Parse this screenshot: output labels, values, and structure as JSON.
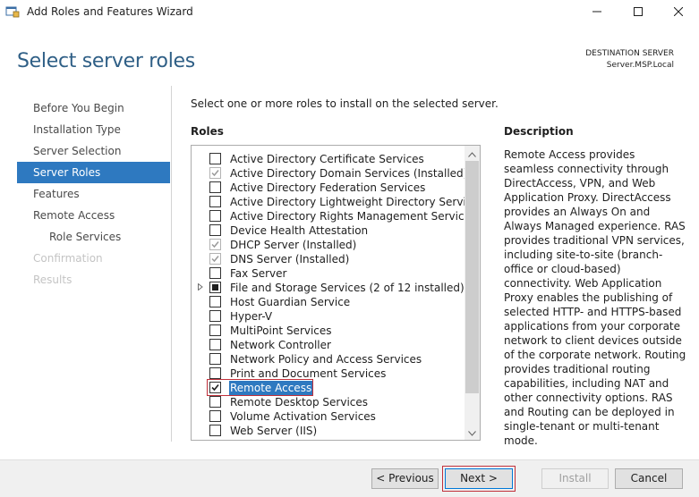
{
  "window": {
    "title": "Add Roles and Features Wizard"
  },
  "header": {
    "page_title": "Select server roles",
    "destination_label": "DESTINATION SERVER",
    "destination_server": "Server.MSP.Local"
  },
  "nav": {
    "items": [
      {
        "label": "Before You Begin",
        "state": "normal"
      },
      {
        "label": "Installation Type",
        "state": "normal"
      },
      {
        "label": "Server Selection",
        "state": "normal"
      },
      {
        "label": "Server Roles",
        "state": "active"
      },
      {
        "label": "Features",
        "state": "normal"
      },
      {
        "label": "Remote Access",
        "state": "normal"
      },
      {
        "label": "Role Services",
        "state": "normal"
      },
      {
        "label": "Confirmation",
        "state": "disabled"
      },
      {
        "label": "Results",
        "state": "disabled"
      }
    ]
  },
  "main": {
    "intro": "Select one or more roles to install on the selected server.",
    "roles_heading": "Roles",
    "description_heading": "Description",
    "description": "Remote Access provides seamless connectivity through DirectAccess, VPN, and Web Application Proxy. DirectAccess provides an Always On and Always Managed experience. RAS provides traditional VPN services, including site-to-site (branch-office or cloud-based) connectivity. Web Application Proxy enables the publishing of selected HTTP- and HTTPS-based applications from your corporate network to client devices outside of the corporate network. Routing provides traditional routing capabilities, including NAT and other connectivity options. RAS and Routing can be deployed in single-tenant or multi-tenant mode."
  },
  "roles": [
    {
      "label": "Active Directory Certificate Services",
      "state": "unchecked"
    },
    {
      "label": "Active Directory Domain Services (Installed)",
      "state": "installed"
    },
    {
      "label": "Active Directory Federation Services",
      "state": "unchecked"
    },
    {
      "label": "Active Directory Lightweight Directory Services",
      "state": "unchecked"
    },
    {
      "label": "Active Directory Rights Management Services",
      "state": "unchecked"
    },
    {
      "label": "Device Health Attestation",
      "state": "unchecked"
    },
    {
      "label": "DHCP Server (Installed)",
      "state": "installed"
    },
    {
      "label": "DNS Server (Installed)",
      "state": "installed"
    },
    {
      "label": "Fax Server",
      "state": "unchecked"
    },
    {
      "label": "File and Storage Services (2 of 12 installed)",
      "state": "partial",
      "expandable": true
    },
    {
      "label": "Host Guardian Service",
      "state": "unchecked"
    },
    {
      "label": "Hyper-V",
      "state": "unchecked"
    },
    {
      "label": "MultiPoint Services",
      "state": "unchecked"
    },
    {
      "label": "Network Controller",
      "state": "unchecked"
    },
    {
      "label": "Network Policy and Access Services",
      "state": "unchecked"
    },
    {
      "label": "Print and Document Services",
      "state": "unchecked"
    },
    {
      "label": "Remote Access",
      "state": "checked",
      "selected": true
    },
    {
      "label": "Remote Desktop Services",
      "state": "unchecked"
    },
    {
      "label": "Volume Activation Services",
      "state": "unchecked"
    },
    {
      "label": "Web Server (IIS)",
      "state": "unchecked"
    }
  ],
  "buttons": {
    "previous": "< Previous",
    "next": "Next >",
    "install": "Install",
    "cancel": "Cancel"
  },
  "icons": {
    "app": "server-manager-icon",
    "minimize": "minimize-icon",
    "maximize": "maximize-icon",
    "close": "close-icon",
    "expander": "expand-triangle-icon",
    "scroll_up": "chevron-up-icon",
    "scroll_down": "chevron-down-icon"
  },
  "colors": {
    "accent": "#2e79c0",
    "title": "#2f5f86",
    "highlight_border": "#c0303a"
  }
}
